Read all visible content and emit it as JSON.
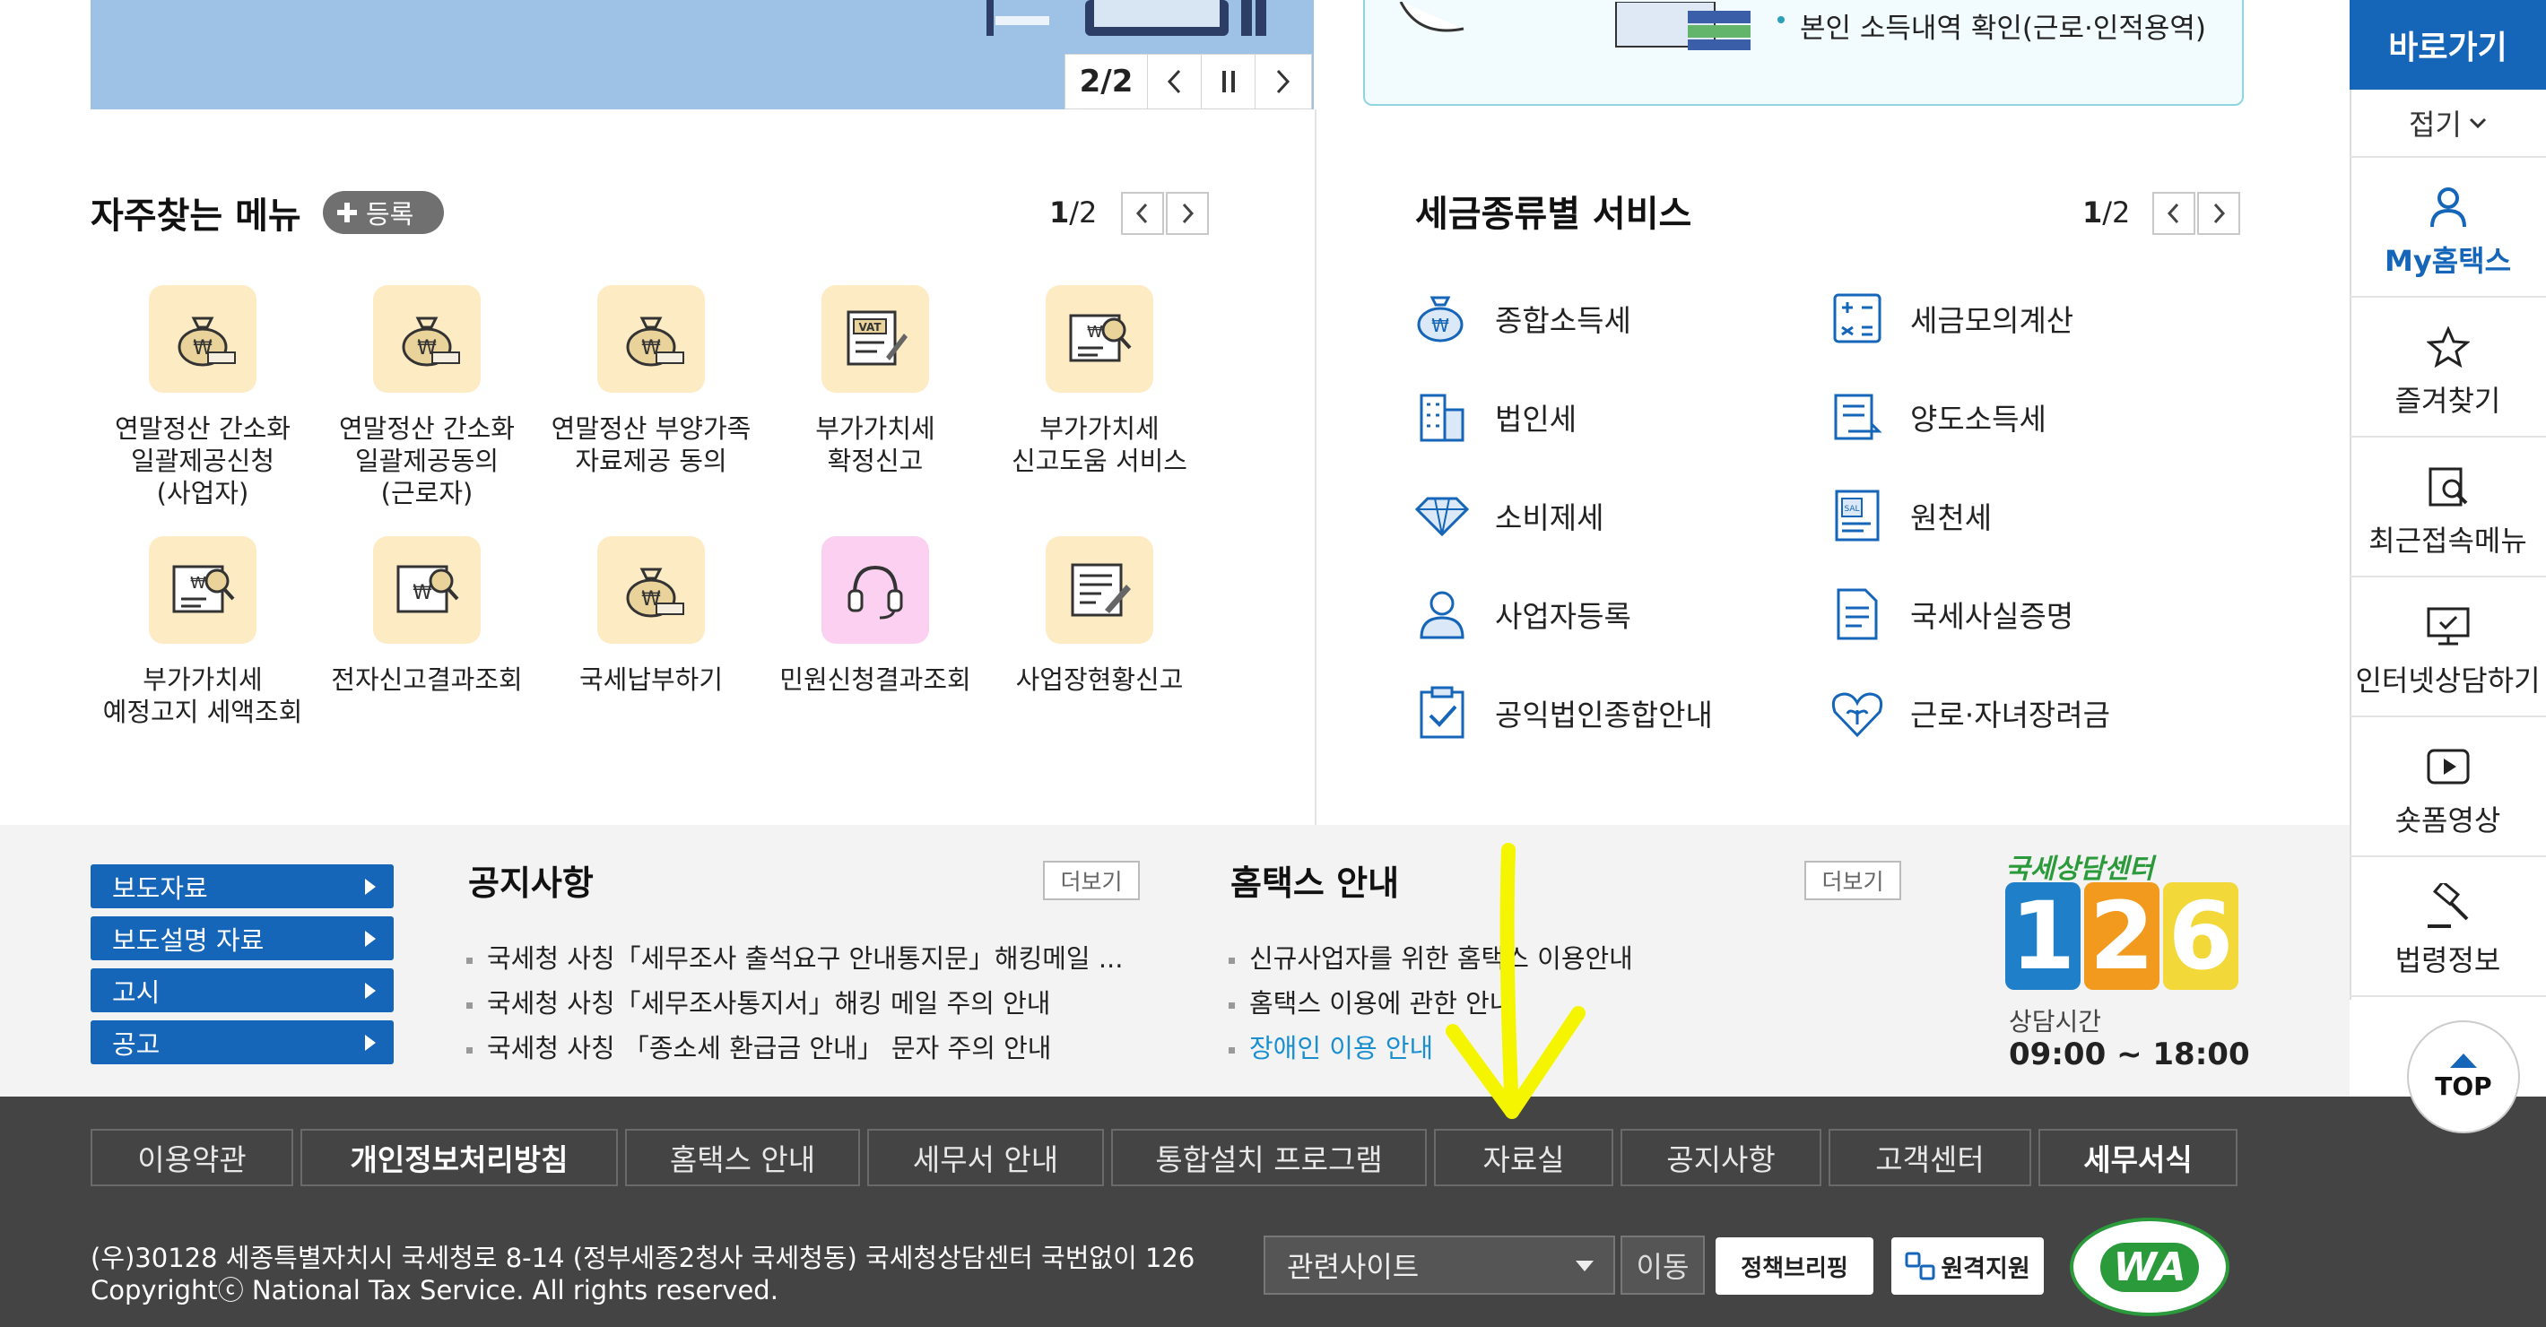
{
  "banner": {
    "pager": {
      "current": "2/2"
    },
    "right_text": "본인 소득내역 확인(근로·인적용역)"
  },
  "frequent_menu": {
    "title": "자주찾는 메뉴",
    "register_label": "등록",
    "page": {
      "current": "1",
      "total": "/2"
    },
    "items": [
      {
        "label": "연말정산 간소화\n일괄제공신청\n(사업자)",
        "icon": "money-bag-icon"
      },
      {
        "label": "연말정산 간소화\n일괄제공동의\n(근로자)",
        "icon": "money-bag-icon"
      },
      {
        "label": "연말정산 부양가족\n자료제공 동의",
        "icon": "money-bag-icon"
      },
      {
        "label": "부가가치세\n확정신고",
        "icon": "vat-document-icon"
      },
      {
        "label": "부가가치세\n신고도움 서비스",
        "icon": "document-search-icon"
      },
      {
        "label": "부가가치세\n예정고지 세액조회",
        "icon": "document-search-icon"
      },
      {
        "label": "전자신고결과조회",
        "icon": "document-search-icon"
      },
      {
        "label": "국세납부하기",
        "icon": "money-bag-icon"
      },
      {
        "label": "민원신청결과조회",
        "icon": "headset-icon"
      },
      {
        "label": "사업장현황신고",
        "icon": "document-edit-icon"
      }
    ]
  },
  "tax_services": {
    "title": "세금종류별 서비스",
    "page": {
      "current": "1",
      "total": "/2"
    },
    "items": [
      {
        "label": "종합소득세",
        "icon": "money-bag-icon"
      },
      {
        "label": "세금모의계산",
        "icon": "calculator-icon"
      },
      {
        "label": "법인세",
        "icon": "building-icon"
      },
      {
        "label": "양도소득세",
        "icon": "transfer-document-icon"
      },
      {
        "label": "소비제세",
        "icon": "diamond-icon"
      },
      {
        "label": "원천세",
        "icon": "salary-document-icon"
      },
      {
        "label": "사업자등록",
        "icon": "person-icon"
      },
      {
        "label": "국세사실증명",
        "icon": "certificate-icon"
      },
      {
        "label": "공익법인종합안내",
        "icon": "clipboard-check-icon"
      },
      {
        "label": "근로·자녀장려금",
        "icon": "heart-sprout-icon"
      }
    ]
  },
  "quick_links": [
    "보도자료",
    "보도설명 자료",
    "고시",
    "공고"
  ],
  "notices": {
    "title": "공지사항",
    "more": "더보기",
    "items": [
      "국세청 사칭「세무조사 출석요구 안내통지문」해킹메일 ...",
      "국세청 사칭「세무조사통지서」해킹 메일 주의 안내",
      "국세청 사칭 「종소세 환급금 안내」 문자 주의 안내"
    ]
  },
  "hometax_guide": {
    "title": "홈택스 안내",
    "more": "더보기",
    "items": [
      "신규사업자를 위한 홈택스 이용안내",
      "홈택스 이용에 관한 안내",
      "장애인 이용 안내"
    ]
  },
  "call_center": {
    "label": "국세상담센터",
    "number": "126",
    "hours_label": "상담시간",
    "hours": "09:00 ~ 18:00"
  },
  "footer": {
    "nav": [
      "이용약관",
      "개인정보처리방침",
      "홈택스 안내",
      "세무서 안내",
      "통합설치 프로그램",
      "자료실",
      "공지사항",
      "고객센터",
      "세무서식"
    ],
    "address": "(우)30128 세종특별자치시 국세청로 8-14 (정부세종2청사 국세청동) 국세청상담센터 국번없이 126",
    "copyright": "Copyrightⓒ National Tax Service. All rights reserved.",
    "related_site": "관련사이트",
    "go_label": "이동",
    "policy_briefing": "정책브리핑",
    "remote_support": "원격지원",
    "wa_mark": "WA"
  },
  "quick_bar": {
    "title": "바로가기",
    "collapse": "접기",
    "items": [
      "My홈택스",
      "즐겨찾기",
      "최근접속메뉴",
      "인터넷상담하기",
      "숏폼영상",
      "법령정보"
    ],
    "top": "TOP"
  },
  "colors": {
    "primary_blue": "#1565b8",
    "banner_blue": "#9ec2e6",
    "icon_bg": "#fdebc4",
    "footer_bg": "#444444",
    "annotation_arrow": "#f5f500"
  }
}
